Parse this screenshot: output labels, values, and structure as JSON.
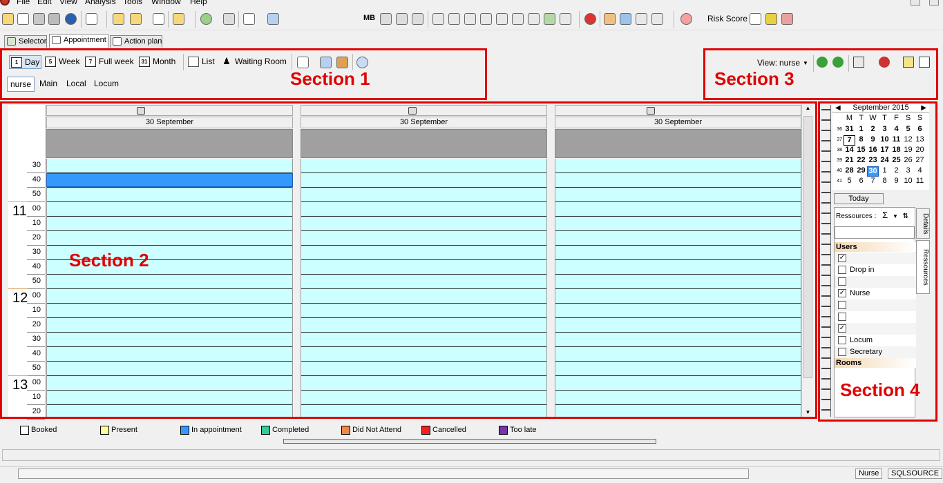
{
  "menu": {
    "items": [
      "File",
      "Edit",
      "View",
      "Analysis",
      "Tools",
      "Window",
      "Help"
    ]
  },
  "toolbar": {
    "mb_label": "MB",
    "risk_score_label": "Risk Score"
  },
  "tabs": [
    {
      "label": "Selector",
      "active": false
    },
    {
      "label": "Appointment",
      "active": true
    },
    {
      "label": "Action plan",
      "active": false
    }
  ],
  "section_labels": {
    "s1": "Section 1",
    "s2": "Section 2",
    "s3": "Section 3",
    "s4": "Section 4"
  },
  "view_buttons": [
    {
      "label": "Day",
      "icon": "day-icon",
      "icon_text": "1",
      "selected": true
    },
    {
      "label": "Week",
      "icon": "week-icon",
      "icon_text": "5",
      "selected": false
    },
    {
      "label": "Full week",
      "icon": "full-week-icon",
      "icon_text": "7",
      "selected": false
    },
    {
      "label": "Month",
      "icon": "month-icon",
      "icon_text": "31",
      "selected": false
    },
    {
      "label": "List",
      "icon": "list-icon",
      "icon_text": "",
      "selected": false
    },
    {
      "label": "Waiting Room",
      "icon": "person-icon",
      "icon_text": "",
      "selected": false
    }
  ],
  "selector_tabs": [
    {
      "label": "nurse",
      "selected": true
    },
    {
      "label": "Main",
      "selected": false
    },
    {
      "label": "Local",
      "selected": false
    },
    {
      "label": "Locum",
      "selected": false
    }
  ],
  "calendar": {
    "columns": [
      {
        "date": "30 September"
      },
      {
        "date": "30 September"
      },
      {
        "date": "30 September"
      }
    ],
    "time_slots": [
      {
        "hour": "",
        "minute": "30"
      },
      {
        "hour": "",
        "minute": "40"
      },
      {
        "hour": "",
        "minute": "50"
      },
      {
        "hour": "11",
        "minute": "00"
      },
      {
        "hour": "",
        "minute": "10"
      },
      {
        "hour": "",
        "minute": "20"
      },
      {
        "hour": "",
        "minute": "30"
      },
      {
        "hour": "",
        "minute": "40"
      },
      {
        "hour": "",
        "minute": "50"
      },
      {
        "hour": "12",
        "minute": "00"
      },
      {
        "hour": "",
        "minute": "10"
      },
      {
        "hour": "",
        "minute": "20"
      },
      {
        "hour": "",
        "minute": "30"
      },
      {
        "hour": "",
        "minute": "40"
      },
      {
        "hour": "",
        "minute": "50"
      },
      {
        "hour": "13",
        "minute": "00"
      },
      {
        "hour": "",
        "minute": "10"
      },
      {
        "hour": "",
        "minute": "20"
      }
    ],
    "selected_slot_index": 1,
    "slot_color": "#ccffff",
    "selected_color": "#3399ff"
  },
  "legend": [
    {
      "label": "Booked",
      "color": "#ffffff"
    },
    {
      "label": "Present",
      "color": "#ffff99"
    },
    {
      "label": "In appointment",
      "color": "#3399ff"
    },
    {
      "label": "Completed",
      "color": "#33cc99"
    },
    {
      "label": "Did Not Attend",
      "color": "#ee8844"
    },
    {
      "label": "Cancelled",
      "color": "#ee2222"
    },
    {
      "label": "Too late",
      "color": "#7733aa"
    }
  ],
  "view_selector": {
    "label": "View:",
    "value": "nurse"
  },
  "mini_calendar": {
    "month_label": "September 2015",
    "day_headers": [
      "M",
      "T",
      "W",
      "T",
      "F",
      "S",
      "S"
    ],
    "weeks": [
      {
        "wk": "36",
        "days": [
          "31",
          "1",
          "2",
          "3",
          "4",
          "5",
          "6"
        ]
      },
      {
        "wk": "37",
        "days": [
          "7",
          "8",
          "9",
          "10",
          "11",
          "12",
          "13"
        ]
      },
      {
        "wk": "38",
        "days": [
          "14",
          "15",
          "16",
          "17",
          "18",
          "19",
          "20"
        ]
      },
      {
        "wk": "39",
        "days": [
          "21",
          "22",
          "23",
          "24",
          "25",
          "26",
          "27"
        ]
      },
      {
        "wk": "40",
        "days": [
          "28",
          "29",
          "30",
          "1",
          "2",
          "3",
          "4"
        ]
      },
      {
        "wk": "41",
        "days": [
          "5",
          "6",
          "7",
          "8",
          "9",
          "10",
          "11"
        ]
      }
    ],
    "today_button": "Today"
  },
  "resources": {
    "label": "Ressources :",
    "sum_symbol": "Σ",
    "groups": [
      {
        "title": "Users",
        "items": [
          {
            "label": "",
            "checked": true
          },
          {
            "label": "Drop in",
            "checked": false
          },
          {
            "label": "",
            "checked": false
          },
          {
            "label": "Nurse",
            "checked": true
          },
          {
            "label": "",
            "checked": false
          },
          {
            "label": "",
            "checked": false
          },
          {
            "label": "",
            "checked": true
          },
          {
            "label": "Locum",
            "checked": false
          },
          {
            "label": "Secretary",
            "checked": false
          }
        ]
      },
      {
        "title": "Rooms",
        "items": []
      }
    ],
    "side_tabs": [
      "Details",
      "Ressources"
    ]
  },
  "status_bar": {
    "user": "Nurse",
    "source": "SQLSOURCE"
  }
}
